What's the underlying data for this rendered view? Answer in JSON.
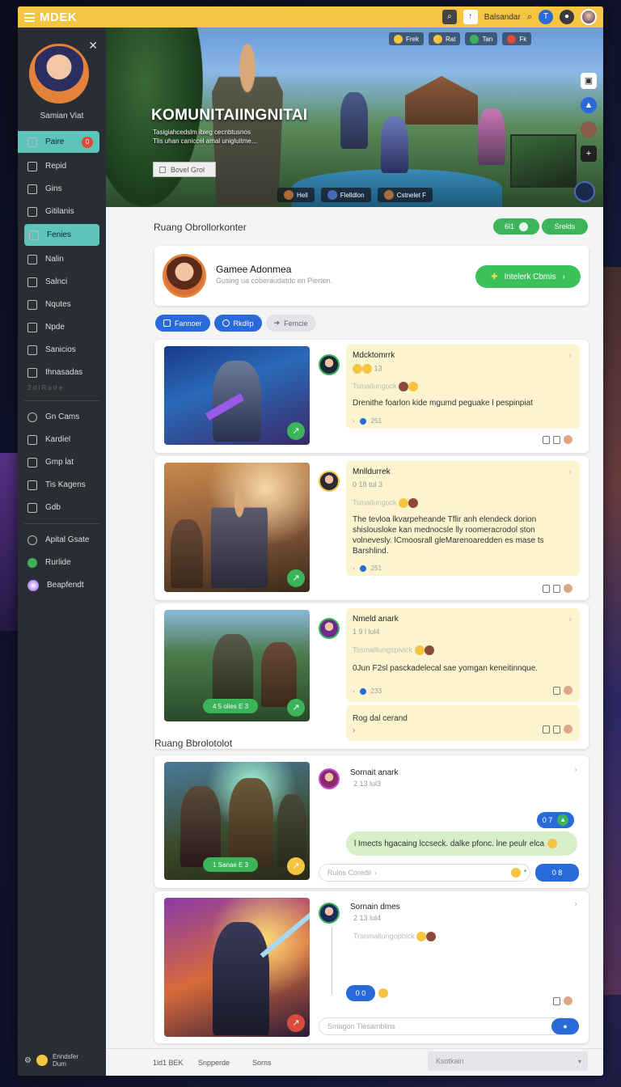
{
  "app": {
    "title": "MDEK"
  },
  "topbar": {
    "search_label": "Balsandar",
    "button_a": "⌕",
    "button_b": "↑"
  },
  "sidebar": {
    "user_name": "Samian Viat",
    "items": [
      {
        "label": "Paire",
        "badge": "0"
      },
      {
        "label": "Repid"
      },
      {
        "label": "Gins"
      },
      {
        "label": "Gitilanis"
      },
      {
        "label": "Fenies"
      },
      {
        "label": "Nalin"
      },
      {
        "label": "Salnci"
      },
      {
        "label": "Nqutes"
      },
      {
        "label": "Npde"
      },
      {
        "label": "Sanicios"
      },
      {
        "label": "Ihnasadas"
      }
    ],
    "dim_label": "2 d l    R a d e",
    "items2": [
      {
        "label": "Gn Cams"
      },
      {
        "label": "Kardiel"
      },
      {
        "label": "Gmp lat"
      },
      {
        "label": "Tis Kagens"
      },
      {
        "label": "Gdb"
      },
      {
        "label": "Apital Gsate"
      },
      {
        "label": "Rurlide"
      },
      {
        "label": "Beapfendt"
      }
    ],
    "footer": "Erindsfer Dum"
  },
  "hero": {
    "title": "KOMUNITAIINGNITAI",
    "subtitle_line1": "Tasigiahcedslm ibieg cecnbtusnos",
    "subtitle_line2": "Tlis uhan caniccel amal unigluitme...",
    "button": "Bovel Grol",
    "chips": [
      "Frek",
      "Rat",
      "Tan",
      "Fk"
    ],
    "bottom_chips": [
      "Hell",
      "Flelldlon",
      "Cstnelet F"
    ]
  },
  "section1": {
    "title": "Ruang Obrollorkonter",
    "pill_a": "6l1",
    "pill_b": "Srelds"
  },
  "profile": {
    "name": "Gamee Adonmea",
    "sub": "Gusing ua coberaudatdc en Pierten.",
    "invite": "Intelerk Cbmis"
  },
  "tabs": [
    {
      "label": "Fannoer"
    },
    {
      "label": "Rkdlip"
    },
    {
      "label": "Femcie"
    }
  ],
  "posts": [
    {
      "name": "Mdcktomrrk",
      "meta": "13",
      "label": "Tsmallungock",
      "text": "Drenithe foarlon kide mgumd peguake l pespinpiat",
      "stat": "251"
    },
    {
      "name": "Mnlldurrek",
      "meta": "0 18 tul 3",
      "label": "Tsmallungock",
      "text": "The tevloa lkvarpeheande Tflir anh elendeck dorion shislousloke kan mednocsle lly roomeracrodol ston volnevesly. lCmoosrall gleMarenoaredden es mase ts Barshlind.",
      "stat": "251"
    },
    {
      "name": "Nmeld anark",
      "meta": "1 9 l lul4",
      "label": "Tssmalllungspivick",
      "text": "0Jun F2sl pasckadelecal sae yomgan keneitinnque.",
      "stat": "233",
      "thumb_pill": "4 5 olies E 3"
    }
  ],
  "reply_box": {
    "text": "Rog dal cerand"
  },
  "section2": {
    "title": "Ruang Bbrolotolot"
  },
  "posts2": [
    {
      "name": "Sornait anark",
      "meta": "2 13 lul3",
      "count": "0 7",
      "message": "l Imects hgacaing lccseck. dalke pfonc. lne peulr elca",
      "reply_placeholder": "Rulos Coredil",
      "pill": "0 8",
      "thumb_pill": "1 Sanae E 3"
    },
    {
      "name": "Sornain dmes",
      "meta": "2 13 lul4",
      "label": "Tranmallungopbick",
      "count": "0 0",
      "reply_placeholder": "Smagon Tlesamblins"
    }
  ],
  "bottombar": {
    "a": "1ld1 BEK",
    "b": "Snpperde",
    "c": "Sorns",
    "input": "Ksotkain"
  }
}
